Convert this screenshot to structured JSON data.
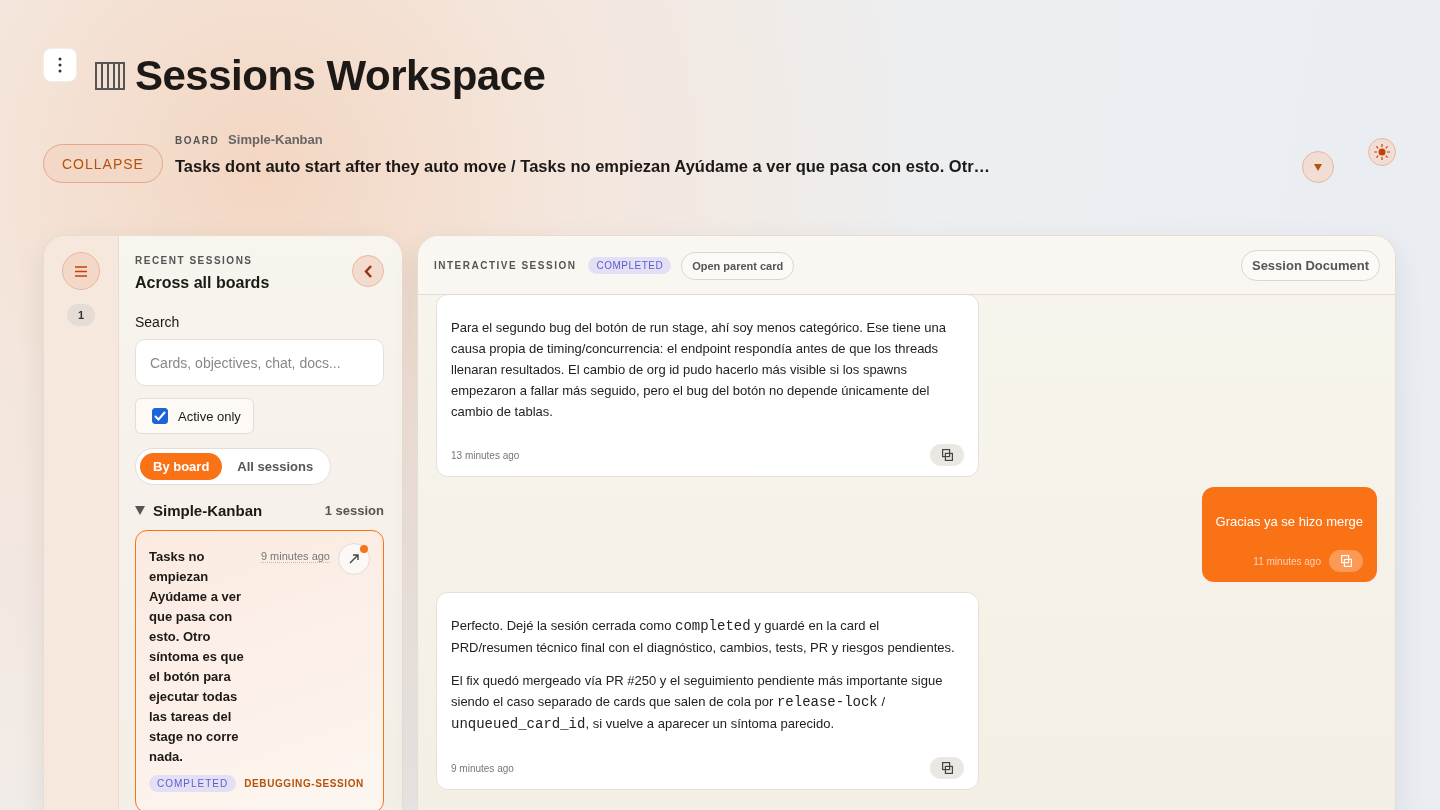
{
  "header": {
    "title": "Sessions Workspace",
    "collapse_label": "COLLAPSE",
    "board_label": "BOARD",
    "board_name": "Simple-Kanban",
    "session_title": "Tasks dont auto start after they auto move / Tasks no empiezan Ayúdame a ver que pasa con esto. Otr…"
  },
  "rail": {
    "count": "1"
  },
  "sidebar": {
    "eyebrow": "RECENT SESSIONS",
    "title": "Across all boards",
    "search": {
      "label": "Search",
      "placeholder": "Cards, objectives, chat, docs..."
    },
    "active_only": {
      "label": "Active only",
      "checked": true
    },
    "views": [
      {
        "label": "By board",
        "selected": true
      },
      {
        "label": "All sessions",
        "selected": false
      }
    ],
    "groups": [
      {
        "name": "Simple-Kanban",
        "count": "1 session",
        "expanded": true,
        "sessions": [
          {
            "title": "Tasks no empiezan Ayúdame a ver que pasa con esto. Otro síntoma es que el botón para ejecutar todas las tareas del stage no corre nada.",
            "time": "9 minutes ago",
            "unread": true,
            "selected": true,
            "status": "COMPLETED",
            "tag": "DEBUGGING-SESSION"
          }
        ]
      }
    ]
  },
  "session": {
    "eyebrow": "INTERACTIVE SESSION",
    "status": "COMPLETED",
    "open_parent_label": "Open parent card",
    "document_label": "Session Document",
    "messages": [
      {
        "kind": "assistant",
        "time": "13 minutes ago",
        "paragraphs": [
          [
            {
              "text": "Para el segundo bug del botón de run stage, ahí soy menos categórico. Ese tiene una causa propia de timing/concurrencia: el endpoint respondía antes de que los threads llenaran resultados. El cambio de org id pudo hacerlo más visible si los spawns empezaron a fallar más seguido, pero el bug del botón no depende únicamente del cambio de tablas."
            }
          ]
        ]
      },
      {
        "kind": "user",
        "time": "11 minutes ago",
        "paragraphs": [
          [
            {
              "text": "Gracias ya se hizo merge"
            }
          ]
        ]
      },
      {
        "kind": "assistant",
        "time": "9 minutes ago",
        "paragraphs": [
          [
            {
              "text": "Perfecto. Dejé la sesión cerrada como "
            },
            {
              "code": "completed"
            },
            {
              "text": " y guardé en la card el PRD/resumen técnico final con el diagnóstico, cambios, tests, PR y riesgos pendientes."
            }
          ],
          [
            {
              "text": "El fix quedó mergeado vía PR #250 y el seguimiento pendiente más importante sigue siendo el caso separado de cards que salen de cola por "
            },
            {
              "code": "release-lock"
            },
            {
              "text": " / "
            },
            {
              "code": "unqueued_card_id"
            },
            {
              "text": ", si vuelve a aparecer un síntoma parecido."
            }
          ]
        ]
      }
    ]
  }
}
